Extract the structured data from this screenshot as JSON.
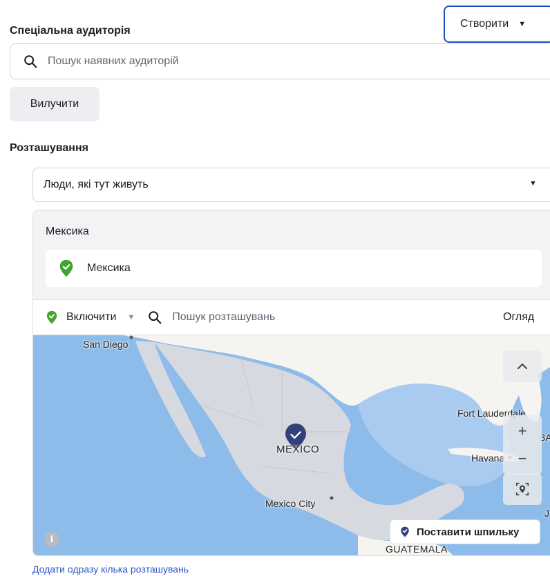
{
  "audience": {
    "title": "Спеціальна аудиторія",
    "create_label": "Створити",
    "search_placeholder": "Пошук наявних аудиторій",
    "exclude_label": "Вилучити"
  },
  "location": {
    "title": "Розташування",
    "type_selected": "Люди, які тут живуть",
    "group_title": "Мексика",
    "selected_item": "Мексика",
    "include_label": "Включити",
    "search_placeholder": "Пошук розташувань",
    "overview_label": "Огляд",
    "drop_pin_label": "Поставити шпильку",
    "add_bulk_link": "Додати одразу кілька розташувань",
    "map_labels": {
      "san_diego": "San Diego",
      "mexico": "MEXICO",
      "mexico_city": "Mexico City",
      "fort_lauderdale": "Fort Lauderdale",
      "havana": "Havana",
      "guatemala": "GUATEMALA",
      "ba": "BA",
      "j": "J"
    },
    "icons": {
      "search": "search-icon",
      "include_pin": "check-pin-icon",
      "info": "info-icon"
    }
  },
  "colors": {
    "accent_border": "#1b4fc4",
    "include_green": "#42a52f",
    "pin_navy": "#33407a",
    "link_blue": "#2b57c6",
    "water": "#8dbbea",
    "land": "#f5f4f0",
    "selected_land": "#d7d9e0"
  }
}
